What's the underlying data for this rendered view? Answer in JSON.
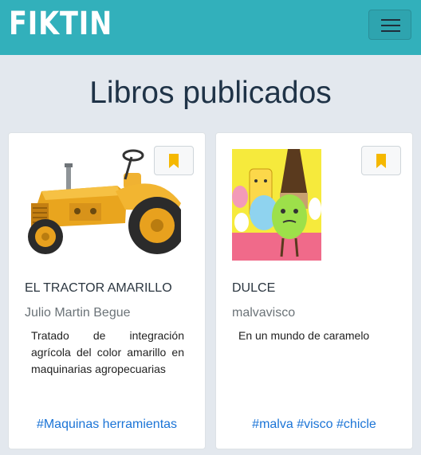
{
  "navbar": {
    "brand": "FIKTIN",
    "menu_icon": "hamburger-icon",
    "colors": {
      "background": "#32b0bb",
      "brand_text": "#ffffff"
    }
  },
  "main": {
    "title": "Libros publicados",
    "books": [
      {
        "title": "EL TRACTOR AMARILLO",
        "author": "Julio Martin Begue",
        "description": "Tratado de integración agrícola del color amarillo en maquinarias agropecuarias",
        "tags": [
          "#Maquinas herramientas"
        ],
        "cover": "yellow-tractor-image",
        "bookmark_icon": "bookmark-icon"
      },
      {
        "title": "DULCE",
        "author": "malvavisco",
        "description": "En un mundo de caramelo",
        "tags": [
          "#malva",
          "#visco",
          "#chicle"
        ],
        "cover": "candy-characters-image",
        "bookmark_icon": "bookmark-icon"
      }
    ],
    "colors": {
      "bookmark": "#f5b800",
      "link": "#1b74d6",
      "page_bg": "#e3e8ee"
    }
  }
}
